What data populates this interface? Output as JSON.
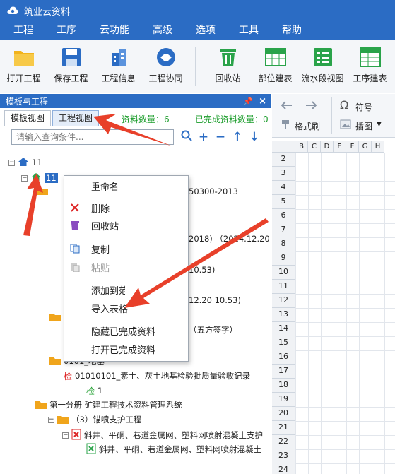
{
  "window": {
    "title": "筑业云资料"
  },
  "menu": [
    "工程",
    "工序",
    "云功能",
    "高级",
    "选项",
    "工具",
    "帮助"
  ],
  "ribbon": {
    "tools_a": [
      {
        "label": "打开工程",
        "icon": "folder-icon"
      },
      {
        "label": "保存工程",
        "icon": "save-icon"
      },
      {
        "label": "工程信息",
        "icon": "building-icon"
      },
      {
        "label": "工程协同",
        "icon": "handshake-icon"
      }
    ],
    "tools_b": [
      {
        "label": "回收站",
        "icon": "recycle-bin-icon"
      },
      {
        "label": "部位建表",
        "icon": "table-icon"
      },
      {
        "label": "流水段视图",
        "icon": "list-view-icon"
      },
      {
        "label": "工序建表",
        "icon": "sheet-icon"
      }
    ]
  },
  "panel": {
    "title": "模板与工程",
    "pin": "📌",
    "close": "×",
    "tabs": [
      "模板视图",
      "工程视图"
    ],
    "doc_count": "资料数量：6",
    "done_count": "已完成资料数量：0",
    "search_placeholder": "请输入查询条件...",
    "search_tools": [
      "+",
      "−",
      "↑",
      "↓"
    ]
  },
  "tree": {
    "root": "11",
    "project": "11",
    "lines": [
      "50300-2013",
      "2018) （2024.12.20 1",
      "10.53)",
      "12.20 10.53)",
      "（五方签字）",
      "0101_地基",
      "01010101_素土、灰土地基检验批质量验收记录",
      "1",
      "第一分册 矿建工程技术资料管理系统",
      "（3）锚喷支护工程",
      "斜井、平硐、巷道金属网、塑料网喷射混凝土支护",
      "斜井、平硐、巷道金属网、塑料网喷射混凝土"
    ]
  },
  "context_menu": {
    "items": [
      "重命名",
      "删除",
      "回收站",
      "复制",
      "粘贴",
      "添加到范例",
      "导入表格",
      "隐藏已完成资料",
      "打开已完成资料"
    ]
  },
  "right_toolbar": {
    "format_brush": "格式刷",
    "symbol": "符号",
    "insert_image": "插图"
  },
  "sheet": {
    "columns": [
      "B",
      "C",
      "D",
      "E",
      "F",
      "G",
      "H"
    ],
    "rows": [
      "2",
      "3",
      "4",
      "5",
      "6",
      "7",
      "8",
      "9",
      "10",
      "11",
      "12",
      "13",
      "14",
      "15",
      "16",
      "17",
      "18",
      "19",
      "20",
      "21",
      "22",
      "23",
      "24"
    ]
  },
  "colors": {
    "accent": "#2b6cc4",
    "arrow": "#e8402a",
    "count_green": "#1a9c2a"
  }
}
